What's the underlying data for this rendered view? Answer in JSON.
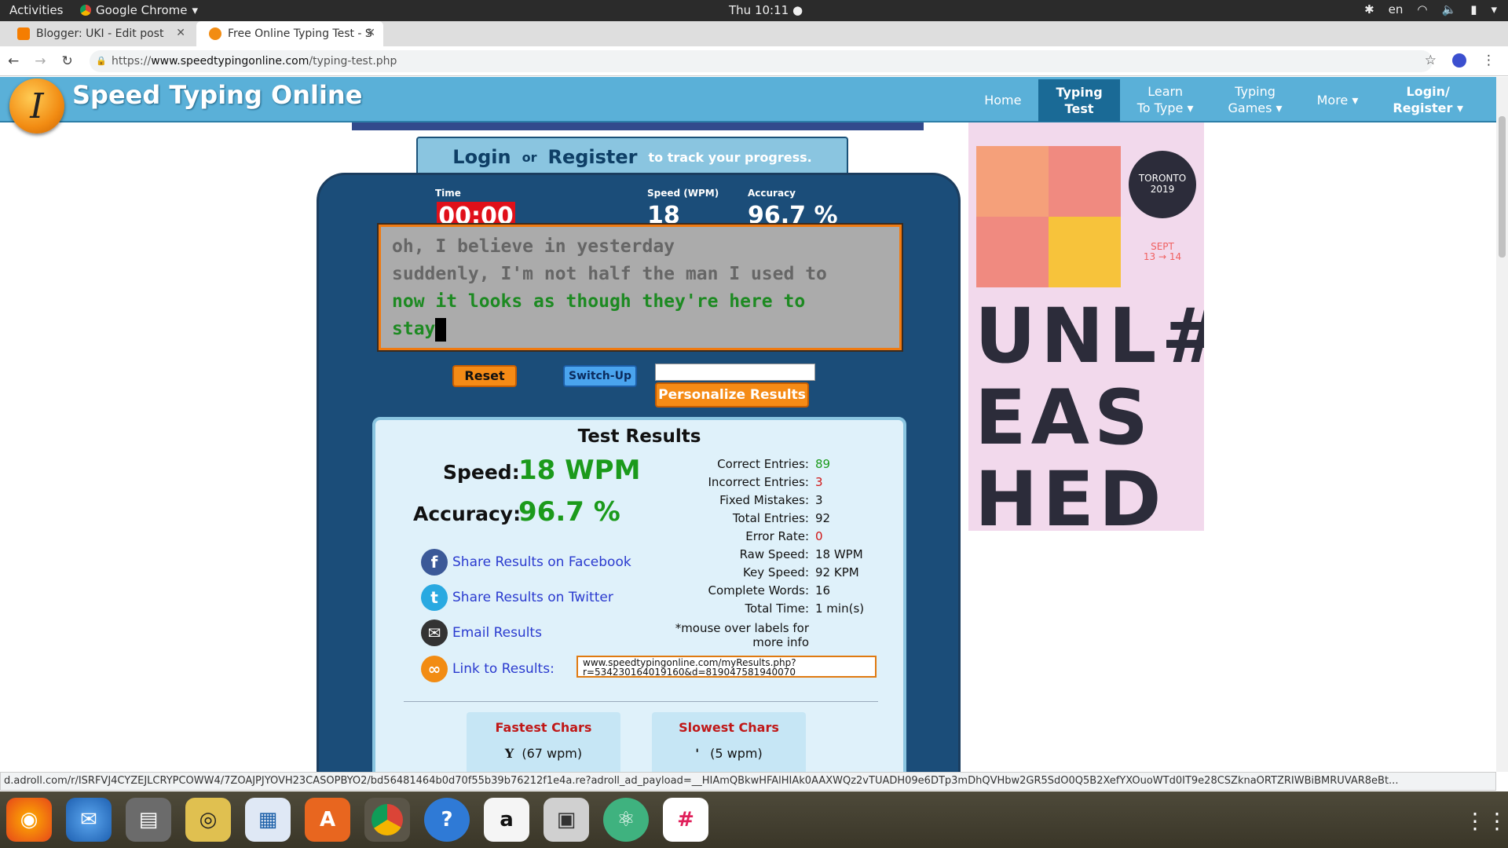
{
  "os": {
    "activities": "Activities",
    "app_name": "Google Chrome",
    "clock": "Thu 10:11 ●",
    "lang": "en"
  },
  "browser": {
    "tabs": [
      {
        "label": "Blogger: UKI - Edit post",
        "fav_color": "#f57d00"
      },
      {
        "label": "Free Online Typing Test - S",
        "fav_color": "#f28c13"
      }
    ],
    "url_prefix": "https://",
    "url_host": "www.speedtypingonline.com",
    "url_path": "/typing-test.php"
  },
  "site": {
    "logo_letter": "I",
    "name": "Speed Typing Online",
    "menu": [
      {
        "line1": "Home",
        "line2": ""
      },
      {
        "line1": "Typing",
        "line2": "Test"
      },
      {
        "line1": "Learn",
        "line2": "To Type ▾"
      },
      {
        "line1": "Typing",
        "line2": "Games ▾"
      },
      {
        "line1": "More ▾",
        "line2": ""
      },
      {
        "line1": "Login/",
        "line2": "Register ▾"
      }
    ]
  },
  "login": {
    "login": "Login",
    "or": "or",
    "register": "Register",
    "tail": "to track your progress."
  },
  "test": {
    "time_label": "Time",
    "time": "00:00",
    "speed_label": "Speed (WPM)",
    "speed": "18",
    "accuracy_label": "Accuracy",
    "accuracy": "96.7 %",
    "lines_done": [
      "oh, I believe in yesterday",
      "suddenly, I'm not half the man I used to"
    ],
    "lines_ok": [
      "now it looks as though they're here to",
      "stay"
    ],
    "reset": "Reset",
    "switch": "Switch-Up",
    "personalize": "Personalize Results"
  },
  "results": {
    "title": "Test Results",
    "speed_label": "Speed:",
    "speed_value": "18 WPM",
    "accuracy_label": "Accuracy:",
    "accuracy_value": "96.7 %",
    "share_facebook": "Share Results on Facebook",
    "share_twitter": "Share Results on Twitter",
    "email": "Email Results",
    "link_label": "Link to Results:",
    "link_url": "www.speedtypingonline.com/myResults.php?r=534230164019160&d=819047581940070",
    "stats": [
      {
        "k": "Correct Entries:",
        "v": "89",
        "color": "#1b9a1b"
      },
      {
        "k": "Incorrect Entries:",
        "v": "3",
        "color": "#d01515"
      },
      {
        "k": "Fixed Mistakes:",
        "v": "3",
        "color": "#111"
      },
      {
        "k": "Total Entries:",
        "v": "92",
        "color": "#111"
      },
      {
        "k": "Error Rate:",
        "v": "0",
        "color": "#d01515"
      },
      {
        "k": "Raw Speed:",
        "v": "18 WPM",
        "color": "#111"
      },
      {
        "k": "Key Speed:",
        "v": "92 KPM",
        "color": "#111"
      },
      {
        "k": "Complete Words:",
        "v": "16",
        "color": "#111"
      },
      {
        "k": "Total Time:",
        "v": "1 min(s)",
        "color": "#111"
      }
    ],
    "mouse_note_1": "*mouse over labels for",
    "mouse_note_2": "more info",
    "fastest_title": "Fastest Chars",
    "fastest_char": "Y",
    "fastest_value": "(67 wpm)",
    "slowest_title": "Slowest Chars",
    "slowest_char": "'",
    "slowest_value": "(5 wpm)"
  },
  "ad": {
    "city": "TORONTO",
    "year": "2019",
    "sept": "SEPT",
    "dates": "13 → 14",
    "wordmark_1": "UNL#",
    "wordmark_2": "EAS",
    "wordmark_3": "HED"
  },
  "status": "d.adroll.com/r/ISRFVJ4CYZEJLCRYPCOWW4/7ZOAJPJYOVH23CASOPBYO2/bd56481464b0d70f55b39b76212f1e4a.re?adroll_ad_payload=__HIAmQBkwHFAlHIAk0AAXWQz2vTUADH09e6DTp3mDhQVHbw2GR5SdO0Q5B2XefYXOuoWTd0IT9e28CSZknaORTZRIWBiBMRUVAR8eBt...",
  "dock": [
    "firefox-icon",
    "thunderbird-icon",
    "files-icon",
    "rhythmbox-icon",
    "writer-icon",
    "software-icon",
    "chrome-icon",
    "help-icon",
    "amazon-icon",
    "camera-icon",
    "atom-icon",
    "slack-icon"
  ]
}
